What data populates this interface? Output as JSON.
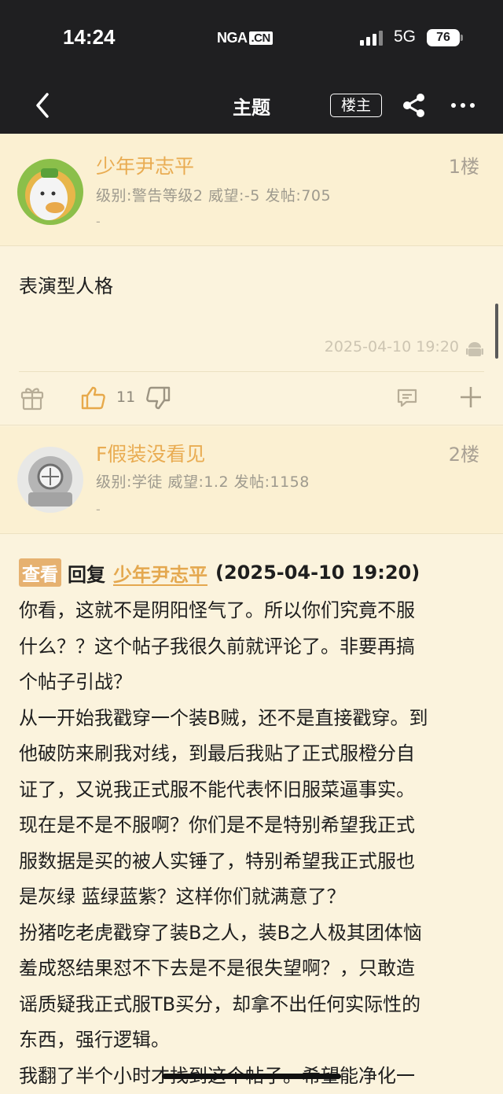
{
  "status_bar": {
    "time": "14:24",
    "app_logo": "NGA",
    "app_logo_cn": ".CN",
    "network": "5G",
    "battery": "76"
  },
  "nav": {
    "title": "主题",
    "owner_label": "楼主",
    "icons": [
      "back-arrow-icon",
      "share-icon",
      "more-icon"
    ]
  },
  "posts": [
    {
      "author": "少年尹志平",
      "floor": "1楼",
      "meta": "级别:警告等级2   威望:-5   发帖:705",
      "signature": "-",
      "content": "表演型人格",
      "timestamp": "2025-04-10 19:20",
      "likes": "11"
    },
    {
      "author": "F假装没看见",
      "floor": "2楼",
      "meta": "级别:学徒   威望:1.2   发帖:1158",
      "signature": "-",
      "reply": {
        "badge": "查看",
        "label": "回复",
        "to_user": "少年尹志平",
        "time": "(2025-04-10 19:20)"
      },
      "lines": [
        "你看，这就不是阴阳怪气了。所以你们究竟不服",
        "什么？？这个帖子我很久前就评论了。非要再搞",
        "个帖子引战？",
        "从一开始我戳穿一个装B贼，还不是直接戳穿。到",
        "他破防来刷我对线，到最后我贴了正式服橙分自",
        "证了，又说我正式服不能代表怀旧服菜逼事实。",
        "现在是不是不服啊？你们是不是特别希望我正式",
        "服数据是买的被人实锤了，特别希望我正式服也",
        "是灰绿 蓝绿蓝紫？这样你们就满意了？",
        "扮猪吃老虎戳穿了装B之人，装B之人极其团体恼",
        "羞成怒结果怼不下去是不是很失望啊？，只敢造",
        "谣质疑我正式服TB买分，却拿不出任何实际性的",
        "东西，强行逻辑。",
        "我翻了半个小时才找到这个帖子。希望能净化一"
      ]
    }
  ],
  "colors": {
    "author": "#e9ac52",
    "background": "#fbf3dd",
    "header": "#1f1f21"
  }
}
